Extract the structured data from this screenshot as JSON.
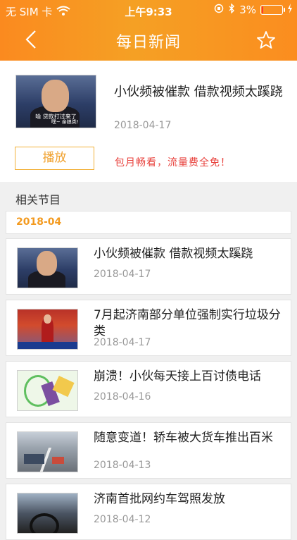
{
  "status_bar": {
    "carrier": "无 SIM 卡",
    "time": "上午9:33",
    "battery": "3%",
    "battery_level": 0.03
  },
  "nav": {
    "title": "每日新闻",
    "icons": [
      "chevron-left-icon",
      "star-icon"
    ]
  },
  "featured": {
    "title": "小伙频被催款 借款视频太蹊跷",
    "date": "2018-04-17",
    "thumb_caption_1": "啥 贷款打过来了",
    "thumb_caption_2": "嘿~ 亲娘类!",
    "play_label": "播放",
    "promo_text": "包月畅看，流量费全免！"
  },
  "related": {
    "heading": "相关节目",
    "month": "2018-04",
    "items": [
      {
        "title": "小伙频被催款 借款视频太蹊跷",
        "date": "2018-04-17",
        "thumb": "portrait"
      },
      {
        "title": "7月起济南部分单位强制实行垃圾分类",
        "date": "2018-04-17",
        "thumb": "news-anchor"
      },
      {
        "title": "崩溃！小伙每天接上百讨债电话",
        "date": "2018-04-16",
        "thumb": "cartoon"
      },
      {
        "title": "随意变道！轿车被大货车推出百米",
        "date": "2018-04-13",
        "thumb": "road"
      },
      {
        "title": "济南首批网约车驾照发放",
        "date": "2018-04-12",
        "thumb": "car-interior"
      }
    ]
  },
  "colors": {
    "accent": "#f39a1f",
    "header": "#fb8a1f",
    "promo": "#e8413c",
    "date": "#999999"
  }
}
